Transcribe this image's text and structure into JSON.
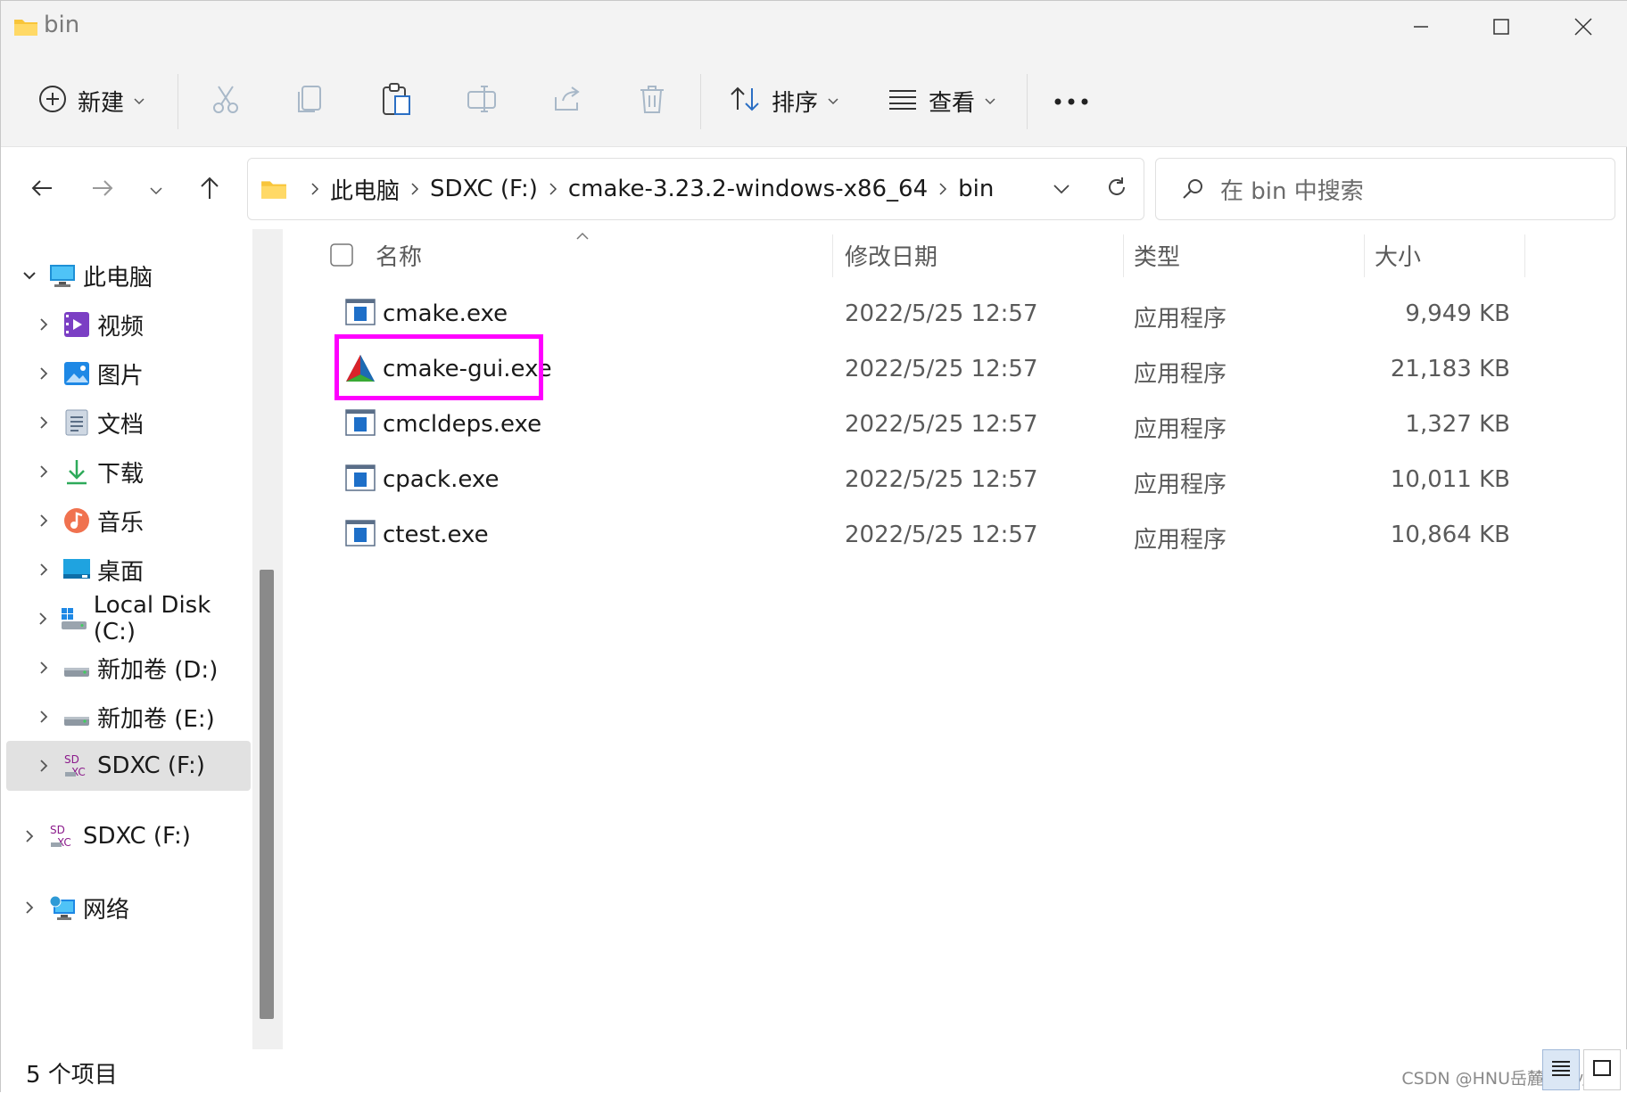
{
  "window": {
    "title": "bin"
  },
  "toolbar": {
    "new_label": "新建",
    "sort_label": "排序",
    "view_label": "查看"
  },
  "address": {
    "crumbs": [
      "此电脑",
      "SDXC (F:)",
      "cmake-3.23.2-windows-x86_64",
      "bin"
    ]
  },
  "search": {
    "placeholder": "在 bin 中搜索"
  },
  "sidebar": {
    "items": [
      {
        "label": "此电脑",
        "icon": "computer-icon"
      },
      {
        "label": "视频",
        "icon": "video-icon"
      },
      {
        "label": "图片",
        "icon": "pictures-icon"
      },
      {
        "label": "文档",
        "icon": "documents-icon"
      },
      {
        "label": "下载",
        "icon": "download-icon"
      },
      {
        "label": "音乐",
        "icon": "music-icon"
      },
      {
        "label": "桌面",
        "icon": "desktop-icon"
      },
      {
        "label": "Local Disk (C:)",
        "icon": "drive-icon"
      },
      {
        "label": "新加卷 (D:)",
        "icon": "drive-icon"
      },
      {
        "label": "新加卷 (E:)",
        "icon": "drive-icon"
      },
      {
        "label": "SDXC (F:)",
        "icon": "sdcard-icon"
      },
      {
        "label": "SDXC (F:)",
        "icon": "sdcard-icon"
      },
      {
        "label": "网络",
        "icon": "network-icon"
      }
    ]
  },
  "columns": {
    "name": "名称",
    "modified": "修改日期",
    "type": "类型",
    "size": "大小"
  },
  "files": [
    {
      "name": "cmake.exe",
      "modified": "2022/5/25 12:57",
      "type": "应用程序",
      "size": "9,949 KB"
    },
    {
      "name": "cmake-gui.exe",
      "modified": "2022/5/25 12:57",
      "type": "应用程序",
      "size": "21,183 KB"
    },
    {
      "name": "cmcldeps.exe",
      "modified": "2022/5/25 12:57",
      "type": "应用程序",
      "size": "1,327 KB"
    },
    {
      "name": "cpack.exe",
      "modified": "2022/5/25 12:57",
      "type": "应用程序",
      "size": "10,011 KB"
    },
    {
      "name": "ctest.exe",
      "modified": "2022/5/25 12:57",
      "type": "应用程序",
      "size": "10,864 KB"
    }
  ],
  "status": {
    "count": "5 个项目"
  },
  "watermark": "CSDN @HNU岳麓山大小姐",
  "colors": {
    "accent": "#0067c0",
    "highlight": "#ff00ff",
    "folder": "#f8c53a"
  }
}
